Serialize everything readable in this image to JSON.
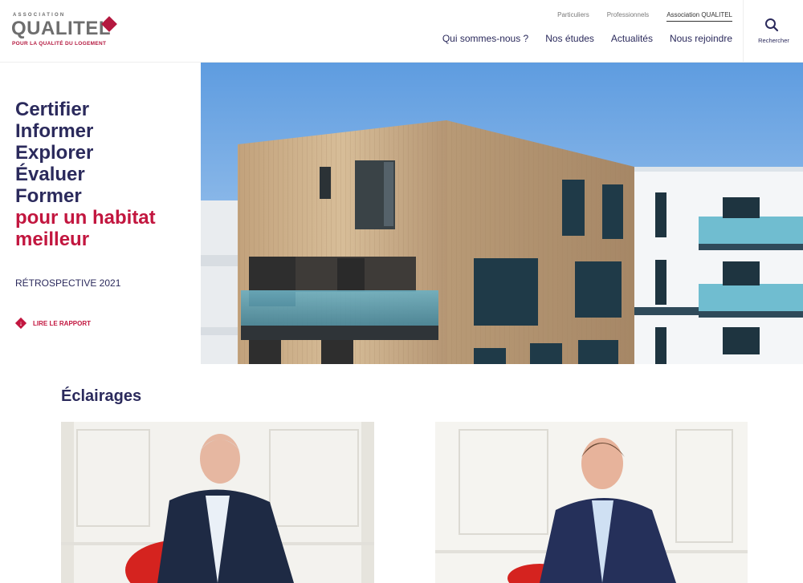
{
  "header": {
    "logo_small": "ASSOCIATION",
    "logo_main": "QUALITEL",
    "logo_tag": "POUR LA QUALITÉ DU LOGEMENT",
    "top_links": [
      "Particuliers",
      "Professionnels",
      "Association QUALITEL"
    ],
    "main_nav": [
      "Qui sommes-nous ?",
      "Nos études",
      "Actualités",
      "Nous rejoindre"
    ],
    "search_label": "Rechercher"
  },
  "hero": {
    "words": [
      "Certifier",
      "Informer",
      "Explorer",
      "Évaluer",
      "Former"
    ],
    "accent_lines": [
      "pour un habitat",
      "meilleur"
    ],
    "retro": "RÉTROSPECTIVE 2021",
    "read_label": "LIRE LE RAPPORT"
  },
  "section": {
    "title": "Éclairages"
  },
  "colors": {
    "navy": "#2b2a5c",
    "accent": "#c2163f"
  }
}
